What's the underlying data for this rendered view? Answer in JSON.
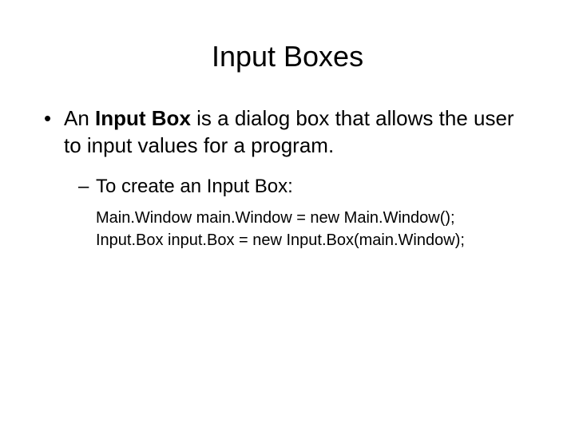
{
  "title": "Input Boxes",
  "bullet1_pre": "An ",
  "bullet1_bold": "Input Box",
  "bullet1_post": " is a dialog box that allows the user to input values for a program.",
  "bullet2": "To create an Input Box:",
  "code1": "Main.Window main.Window = new Main.Window();",
  "code2": "Input.Box input.Box = new Input.Box(main.Window);"
}
